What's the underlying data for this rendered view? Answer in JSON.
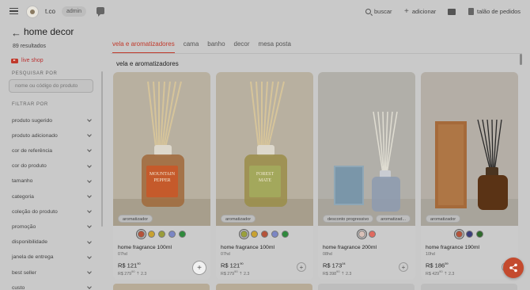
{
  "topbar": {
    "brand": "t.co",
    "admin": "admin",
    "search": "buscar",
    "add": "adicionar",
    "orders": "talão de pedidos"
  },
  "page": {
    "title": "home decor",
    "results": "89 resultados"
  },
  "sidebar": {
    "live_shop": "live shop",
    "search_label": "PESQUISAR POR",
    "search_placeholder": "nome ou código do produto",
    "filter_label": "FILTRAR POR",
    "filters": [
      "produto sugerido",
      "produto adicionado",
      "cor de referência",
      "cor do produto",
      "tamanho",
      "categoria",
      "coleção do produto",
      "promoção",
      "disponibilidade",
      "janela de entrega",
      "best seller",
      "custo"
    ]
  },
  "tabs": [
    "vela e aromatizadores",
    "cama",
    "banho",
    "decor",
    "mesa posta"
  ],
  "active_tab": 0,
  "section_title": "vela e aromatizadores",
  "products": [
    {
      "badges": [
        "aromatizador"
      ],
      "name": "home fragrance 100ml",
      "code": "07hd",
      "price_main": "R$ 121",
      "price_cents": "90",
      "old_main": "R$ 279",
      "old_cents": "90",
      "discount": "2.3",
      "label": "MOUNTAIN PEPPER",
      "swatches": [
        "#b5533a",
        "#c9a230",
        "#9a9d3a",
        "#7b86c4",
        "#2f8a3c"
      ],
      "selected": 0
    },
    {
      "badges": [
        "aromatizador"
      ],
      "name": "home fragrance 100ml",
      "code": "07hd",
      "price_main": "R$ 121",
      "price_cents": "90",
      "old_main": "R$ 279",
      "old_cents": "90",
      "discount": "2.3",
      "label": "FOREST MATE",
      "swatches": [
        "#9aa03b",
        "#c9a230",
        "#b5533a",
        "#7b86c4",
        "#2f8a3c"
      ],
      "selected": 0
    },
    {
      "badges": [
        "desconto progressivo",
        "aromatizad..."
      ],
      "name": "home fragrance 200ml",
      "code": "08hd",
      "price_main": "R$ 173",
      "price_cents": "04",
      "old_main": "R$ 398",
      "old_cents": "90",
      "discount": "2.3",
      "label": "",
      "swatches": [
        "#d9c1b8",
        "#e06a5f"
      ],
      "selected": 0
    },
    {
      "badges": [
        "aromatizador"
      ],
      "name": "home fragrance 190ml",
      "code": "10hd",
      "price_main": "R$ 186",
      "price_cents": "59",
      "old_main": "R$ 429",
      "old_cents": "90",
      "discount": "2.3",
      "label": "",
      "swatches": [
        "#b5533a",
        "#3b3d7a",
        "#2f6a2c"
      ],
      "selected": 0
    }
  ]
}
